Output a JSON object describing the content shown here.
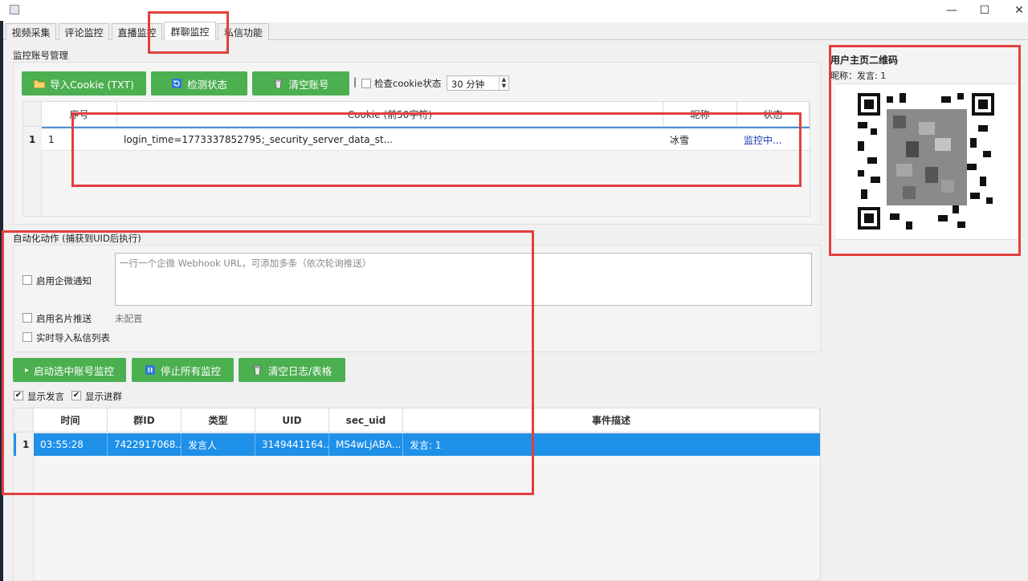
{
  "window": {
    "minimize_glyph": "—",
    "maximize_glyph": "☐",
    "close_glyph": "✕"
  },
  "tabs": [
    {
      "label": "视频采集"
    },
    {
      "label": "评论监控"
    },
    {
      "label": "直播监控"
    },
    {
      "label": "群聊监控"
    },
    {
      "label": "私信功能"
    }
  ],
  "active_tab": "群聊监控",
  "accounts": {
    "section_title": "监控账号管理",
    "import_button": "导入Cookie (TXT)",
    "check_button": "检测状态",
    "clear_button": "清空账号",
    "separator": "|",
    "check_cookie_label": "检查cookie状态",
    "interval_value": "30 分钟",
    "table": {
      "headers": [
        "序号",
        "Cookie (前50字符)",
        "昵称",
        "状态"
      ],
      "rows": [
        {
          "rownum": "1",
          "index": "1",
          "cookie": "login_time=1773337852795;_security_server_data_st...",
          "nickname": "冰雪",
          "status": "监控中..."
        }
      ]
    }
  },
  "automation": {
    "section_title": "自动化动作 (捕获到UID后执行)",
    "wecom_label": "启用企微通知",
    "webhook_placeholder": "一行一个企微 Webhook URL，可添加多条（依次轮询推送）",
    "card_label": "启用名片推送",
    "card_status": "未配置",
    "import_dm_label": "实时导入私信列表"
  },
  "controls": {
    "start_button": "启动选中账号监控",
    "start_glyph": "▸",
    "stop_button": "停止所有监控",
    "clear_log_button": "清空日志/表格",
    "show_speech_label": "显示发言",
    "show_join_label": "显示进群",
    "checkmark": "✔"
  },
  "events": {
    "headers": [
      "时间",
      "群ID",
      "类型",
      "UID",
      "sec_uid",
      "事件描述"
    ],
    "rows": [
      {
        "rownum": "1",
        "time": "03:55:28",
        "group_id": "7422917068...",
        "type": "发言人",
        "uid": "3149441164...",
        "sec_uid": "MS4wLjABA...",
        "desc": "发言: 1"
      }
    ]
  },
  "qr": {
    "title": "用户主页二维码",
    "caption": "昵称：发言: 1"
  },
  "colors": {
    "accent_green": "#4caf50",
    "selection_blue": "#1e90e8",
    "annotation_red": "#e0403f"
  }
}
